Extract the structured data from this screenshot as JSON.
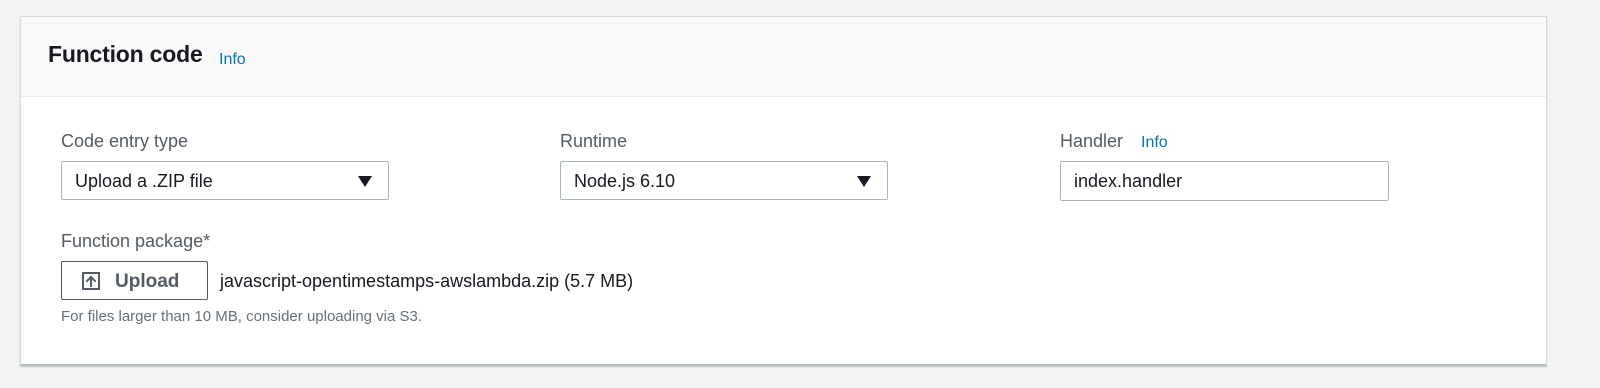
{
  "function_code": {
    "title": "Function code",
    "info_label": "Info"
  },
  "code_entry_type": {
    "label": "Code entry type",
    "selected": "Upload a .ZIP file"
  },
  "runtime": {
    "label": "Runtime",
    "selected": "Node.js 6.10"
  },
  "handler": {
    "label": "Handler",
    "info_label": "Info",
    "value": "index.handler"
  },
  "function_package": {
    "label": "Function package*",
    "upload_label": "Upload",
    "file_name": "javascript-opentimestamps-awslambda.zip (5.7 MB)",
    "help_text": "For files larger than 10 MB, consider uploading via S3."
  },
  "icons": {
    "select_arrow": "caret-down-icon",
    "upload": "upload-icon"
  },
  "colors": {
    "link": "#0073bb",
    "text": "#16191f",
    "label": "#545b64",
    "help": "#687078",
    "border": "#aab7b8"
  }
}
